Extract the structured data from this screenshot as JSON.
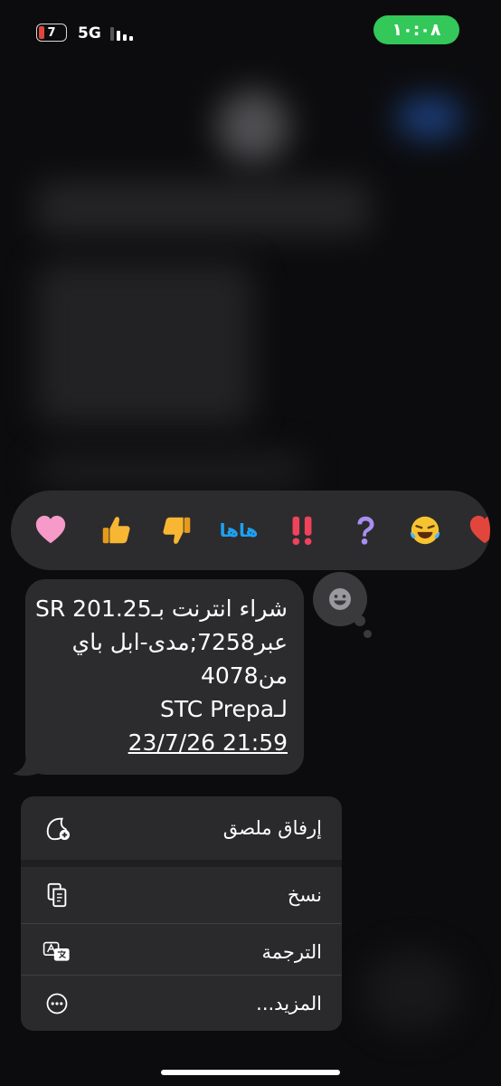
{
  "status_bar": {
    "battery": "7",
    "network": "5G",
    "time": "١٠:٠٨"
  },
  "reactions": {
    "items": [
      "heart-icon",
      "thumbs-up-icon",
      "thumbs-down-icon",
      "haha",
      "exclamation-icon",
      "question-icon",
      "laughing-face-icon"
    ],
    "haha_label": "هاها"
  },
  "message": {
    "lines": [
      "شراء انترنت بـSR 201.25",
      "عبر7258;مدى-ابل باي",
      "من4078",
      "لـSTC Prepa",
      "21:59 23/7/26"
    ]
  },
  "menu": {
    "items": [
      {
        "label": "إرفاق ملصق",
        "icon": "sticker-add-icon"
      },
      {
        "label": "نسخ",
        "icon": "copy-icon"
      },
      {
        "label": "الترجمة",
        "icon": "translate-icon"
      },
      {
        "label": "المزيد...",
        "icon": "more-icon"
      }
    ]
  },
  "colors": {
    "clock_pill": "#34c759",
    "bubble": "#2c2c2e",
    "menu": "#2a2a2c",
    "haha": "#1ea1f2"
  }
}
